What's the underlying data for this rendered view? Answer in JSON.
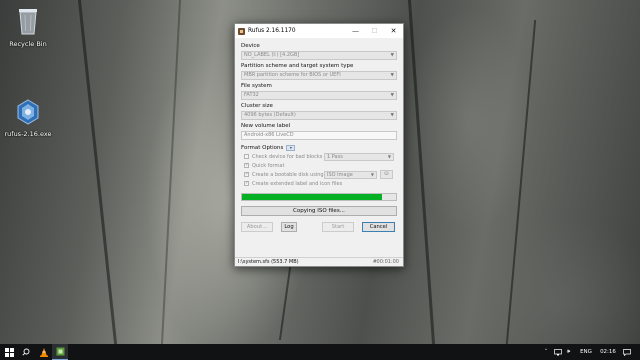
{
  "desktop": {
    "icons": [
      {
        "label": "Recycle Bin",
        "icon": "recycle-bin-icon"
      },
      {
        "label": "rufus-2.16.exe",
        "icon": "rufus-exe-icon"
      }
    ]
  },
  "window": {
    "title": "Rufus 2.16.1170",
    "controls": {
      "minimize": "—",
      "maximize": "☐",
      "close": "✕"
    }
  },
  "device": {
    "label": "Device",
    "value": "NO_LABEL (I:) [4.2GB]"
  },
  "partition": {
    "label": "Partition scheme and target system type",
    "value": "MBR partition scheme for BIOS or UEFI"
  },
  "filesystem": {
    "label": "File system",
    "value": "FAT32"
  },
  "cluster": {
    "label": "Cluster size",
    "value": "4096 bytes (Default)"
  },
  "volume": {
    "label": "New volume label",
    "value": "Android-x86 LiveCD"
  },
  "format_options": {
    "label": "Format Options",
    "toggle": "▾",
    "check_bad_blocks": {
      "label": "Check device for bad blocks",
      "checked": false,
      "passes": "1 Pass"
    },
    "quick_format": {
      "label": "Quick format",
      "checked": true
    },
    "bootable": {
      "label": "Create a bootable disk using",
      "checked": true,
      "image_type": "ISO Image"
    },
    "extended_label": {
      "label": "Create extended label and icon files",
      "checked": true
    }
  },
  "progress": {
    "fraction": 0.91,
    "color": "#06b025"
  },
  "status": {
    "text": "Copying ISO files..."
  },
  "buttons": {
    "about": "About...",
    "log": "Log",
    "start": "Start",
    "cancel": "Cancel"
  },
  "statusbar": {
    "text": "I:\\system.sfs (553.7 MB)",
    "hash": "#",
    "timer": "00:01:00"
  },
  "taskbar": {
    "language": "ENG",
    "time": "02:16"
  }
}
